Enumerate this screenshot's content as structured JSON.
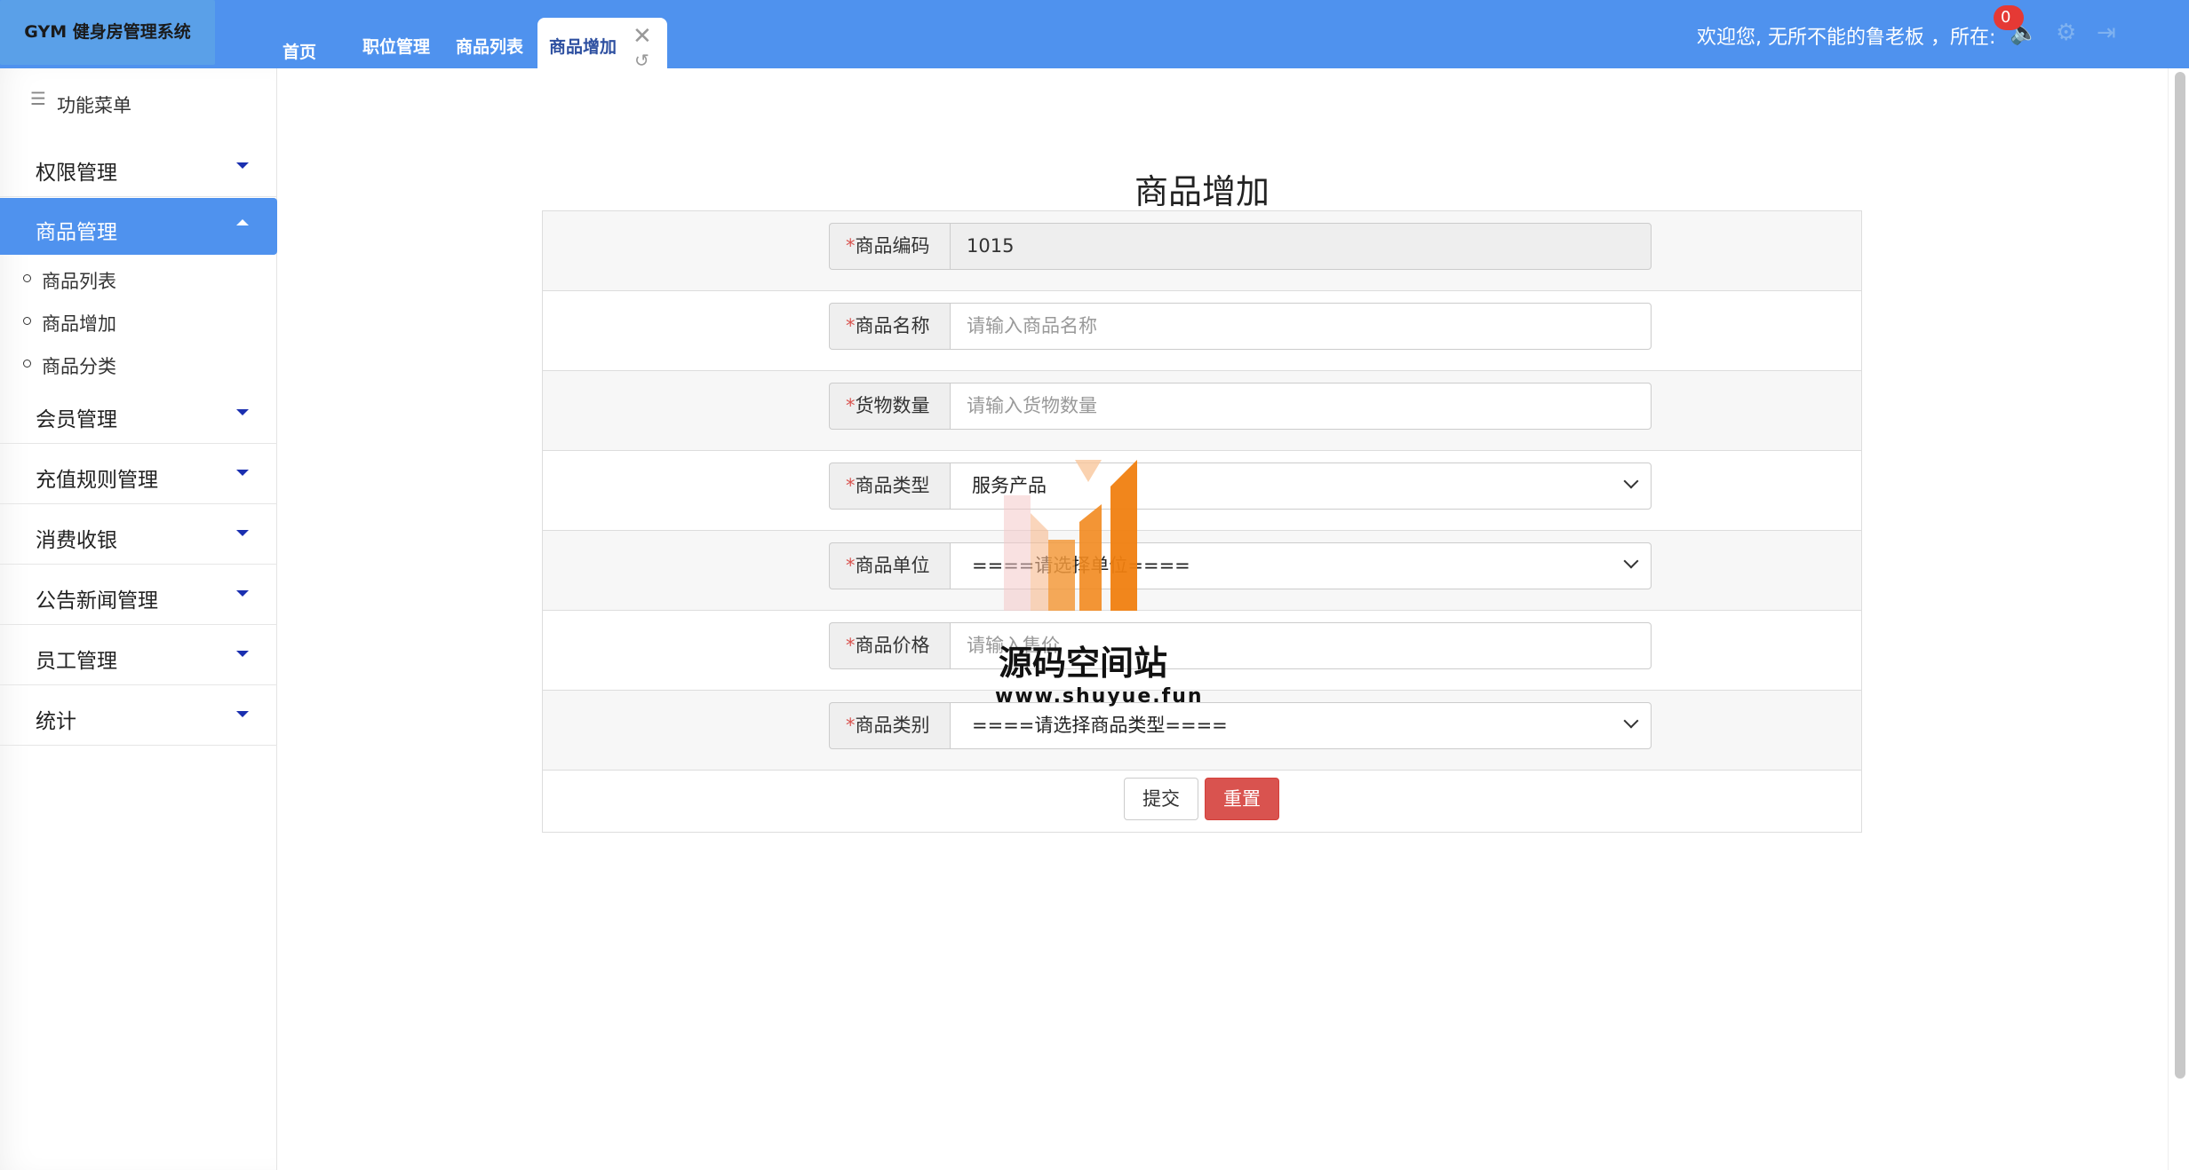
{
  "app": {
    "title": "GYM 健身房管理系统"
  },
  "tabs": [
    {
      "label": "首页"
    },
    {
      "label": "职位管理"
    },
    {
      "label": "商品列表"
    },
    {
      "label": "商品增加",
      "active": true
    }
  ],
  "header": {
    "welcome": "欢迎您, 无所不能的鲁老板 ，所在:",
    "notification_count": "0"
  },
  "sidebar": {
    "title": "功能菜单",
    "items": [
      {
        "label": "权限管理"
      },
      {
        "label": "商品管理",
        "expanded": true
      },
      {
        "label": "会员管理"
      },
      {
        "label": "充值规则管理"
      },
      {
        "label": "消费收银"
      },
      {
        "label": "公告新闻管理"
      },
      {
        "label": "员工管理"
      },
      {
        "label": "统计"
      }
    ],
    "sub_items": [
      {
        "label": "商品列表"
      },
      {
        "label": "商品增加"
      },
      {
        "label": "商品分类"
      }
    ]
  },
  "form": {
    "title": "商品增加",
    "required_mark": "*",
    "fields": [
      {
        "label": "商品编码",
        "value": "1015",
        "placeholder": ""
      },
      {
        "label": "商品名称",
        "value": "",
        "placeholder": "请输入商品名称"
      },
      {
        "label": "货物数量",
        "value": "",
        "placeholder": "请输入货物数量"
      },
      {
        "label": "商品类型",
        "value": "服务产品",
        "placeholder": ""
      },
      {
        "label": "商品单位",
        "value": "====请选择单位====",
        "placeholder": ""
      },
      {
        "label": "商品价格",
        "value": "",
        "placeholder": "请输入售价"
      },
      {
        "label": "商品类别",
        "value": "====请选择商品类型====",
        "placeholder": ""
      }
    ],
    "submit_label": "提交",
    "reset_label": "重置"
  },
  "watermark": {
    "text": "源码空间站",
    "url": "www.shuyue.fun"
  },
  "colors": {
    "header": "#4f92ee",
    "reset_button": "#d9534f",
    "caret": "#1a2fb0"
  }
}
